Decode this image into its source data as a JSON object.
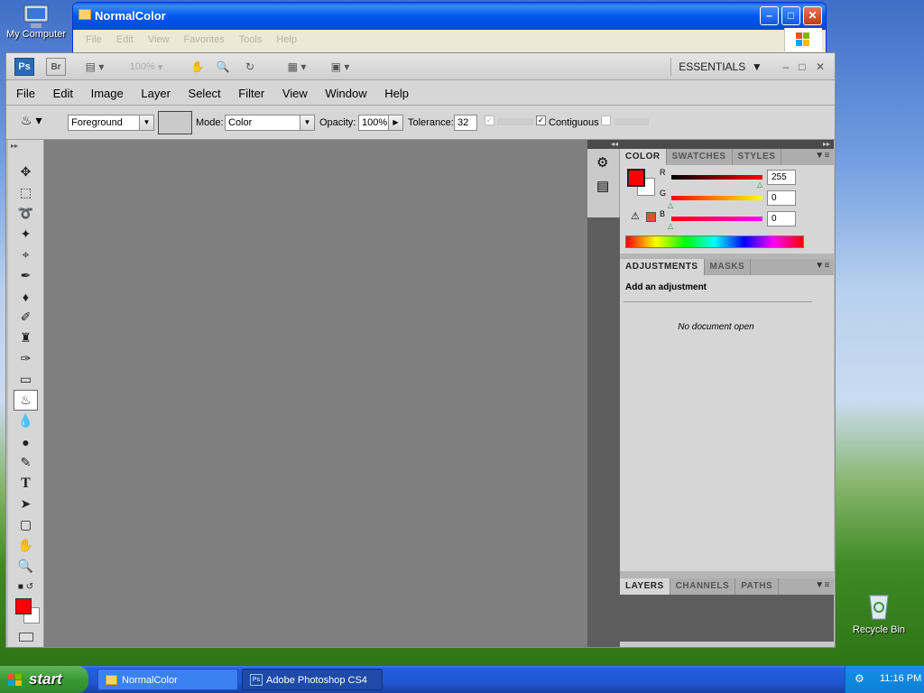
{
  "desktop": {
    "my_computer": "My Computer",
    "recycle_bin": "Recycle Bin"
  },
  "explorer": {
    "title": "NormalColor",
    "menu": [
      "File",
      "Edit",
      "View",
      "Favorites",
      "Tools",
      "Help"
    ]
  },
  "ps": {
    "appbar": {
      "ps_logo": "Ps",
      "bridge": "Br",
      "zoom": "100%",
      "workspace": "ESSENTIALS"
    },
    "menu": [
      "File",
      "Edit",
      "Image",
      "Layer",
      "Select",
      "Filter",
      "View",
      "Window",
      "Help"
    ],
    "options": {
      "fill_source": "Foreground",
      "mode_label": "Mode:",
      "mode_value": "Color",
      "opacity_label": "Opacity:",
      "opacity_value": "100%",
      "tolerance_label": "Tolerance:",
      "tolerance_value": "32",
      "contiguous_label": "Contiguous"
    },
    "color_panel": {
      "tabs": [
        "COLOR",
        "SWATCHES",
        "STYLES"
      ],
      "r_label": "R",
      "g_label": "G",
      "b_label": "B",
      "r": "255",
      "g": "0",
      "b": "0",
      "foreground": "#ff0000",
      "background": "#ffffff"
    },
    "adjustments_panel": {
      "tabs": [
        "ADJUSTMENTS",
        "MASKS"
      ],
      "heading": "Add an adjustment",
      "empty": "No document open"
    },
    "layers_panel": {
      "tabs": [
        "LAYERS",
        "CHANNELS",
        "PATHS"
      ]
    }
  },
  "taskbar": {
    "start": "start",
    "tasks": [
      "NormalColor",
      "Adobe Photoshop CS4"
    ],
    "clock": "11:16 PM"
  }
}
